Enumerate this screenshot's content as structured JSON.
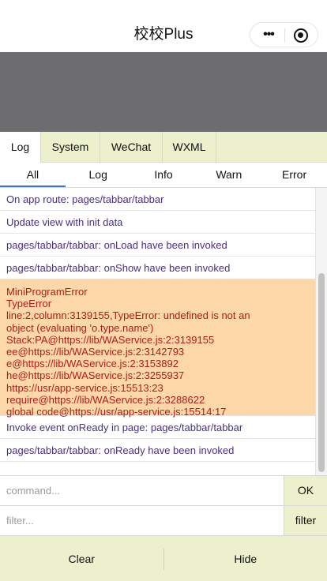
{
  "nav": {
    "title": "校校Plus",
    "more_glyph": "•••"
  },
  "tabs": [
    "Log",
    "System",
    "WeChat",
    "WXML"
  ],
  "filters": [
    "All",
    "Log",
    "Info",
    "Warn",
    "Error"
  ],
  "logs": [
    "On app route: pages/tabbar/tabbar",
    "Update view with init data",
    "pages/tabbar/tabbar: onLoad have been invoked",
    "pages/tabbar/tabbar: onShow have been invoked"
  ],
  "error_lines": [
    "MiniProgramError",
    "TypeError",
    "line:2,column:3139155,TypeError: undefined is not an",
    "object (evaluating 'o.type.name')",
    "Stack:PA@https://lib/WAService.js:2:3139155",
    "ee@https://lib/WAService.js:2:3142793",
    "e@https://lib/WAService.js:2:3153892",
    "he@https://lib/WAService.js:2:3255937",
    "https://usr/app-service.js:15513:23",
    "require@https://lib/WAService.js:2:3288622",
    "global code@https://usr/app-service.js:15514:17"
  ],
  "logs_after": [
    "Invoke event onReady in page: pages/tabbar/tabbar",
    "pages/tabbar/tabbar: onReady have been invoked"
  ],
  "command": {
    "placeholder": "command...",
    "button": "OK"
  },
  "filter": {
    "placeholder": "filter...",
    "button": "filter"
  },
  "bottom": {
    "clear": "Clear",
    "hide": "Hide"
  },
  "colors": {
    "panel_bg": "#ecf0cc",
    "error_bg": "#fcd7a8",
    "error_text": "#b31a1a",
    "log_text": "#4a2e88",
    "filter_active": "#3c6fd9"
  }
}
